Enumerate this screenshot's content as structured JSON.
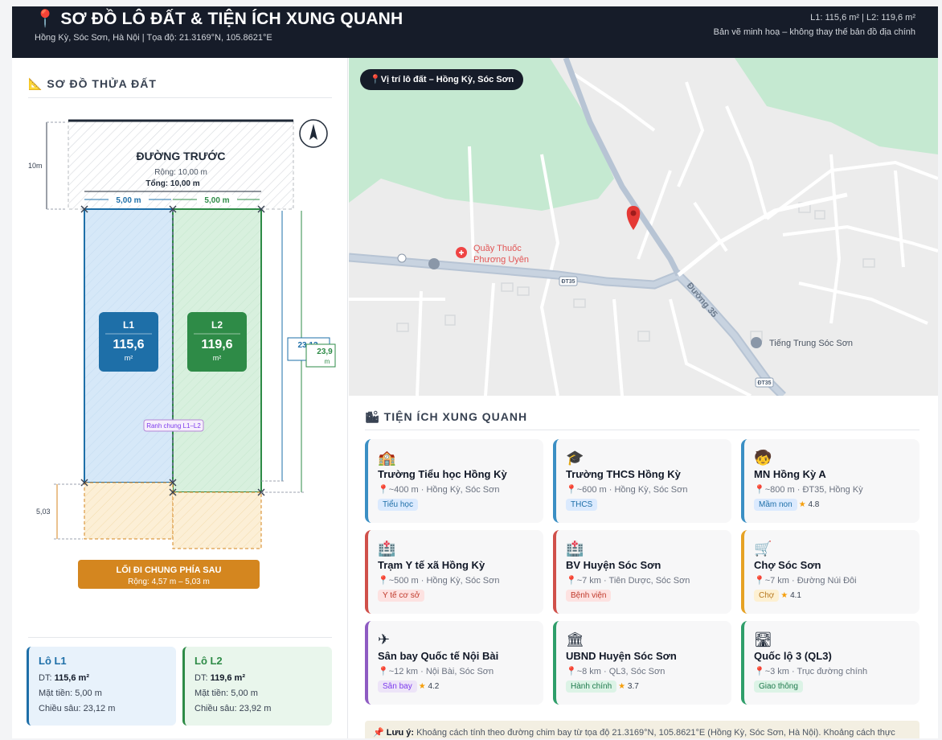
{
  "header": {
    "title": "SƠ ĐỒ LÔ ĐẤT & TIỆN ÍCH XUNG QUANH",
    "subtitle": "Hồng Kỳ, Sóc Sơn, Hà Nội  |  Tọa độ: 21.3169°N, 105.8621°E",
    "areas": "L1: 115,6 m²  |  L2: 119,6 m²",
    "disclaimer": "Bản vẽ minh hoạ – không thay thế bản đồ địa chính"
  },
  "plot": {
    "section_title": "SƠ ĐỒ THỬA ĐẤT",
    "front_road": {
      "label": "ĐƯỜNG TRƯỚC",
      "width": "Rộng: 10,00 m",
      "total": "Tổng: 10,00 m"
    },
    "road_depth_label": "10m",
    "frontage_left": "5,00 m",
    "frontage_right": "5,00 m",
    "lot1": {
      "code": "L1",
      "area": "115,6",
      "unit": "m²",
      "depth": "23,12"
    },
    "lot2": {
      "code": "L2",
      "area": "119,6",
      "unit": "m²",
      "depth": "23,9",
      "depth_unit": "m"
    },
    "shared_boundary": "Ranh chung L1–L2",
    "back_depth": "5,03",
    "back_path": {
      "label": "LỐI ĐI CHUNG PHÍA SAU",
      "width": "Rộng: 4,57 m – 5,03 m"
    }
  },
  "lot_cards": [
    {
      "title": "Lô L1",
      "area_label": "DT: ",
      "area": "115,6 m²",
      "frontage": "Mặt tiền: 5,00 m",
      "depth": "Chiều sâu: 23,12 m"
    },
    {
      "title": "Lô L2",
      "area_label": "DT: ",
      "area": "119,6 m²",
      "frontage": "Mặt tiền: 5,00 m",
      "depth": "Chiều sâu: 23,92 m"
    }
  ],
  "map": {
    "badge": "Vị trí lô đất – Hồng Kỳ, Sóc Sơn",
    "pharmacy": "Quầy Thuốc",
    "pharmacy2": "Phương Uyên",
    "school": "Tiếng Trung Sóc Sơn",
    "road_name": "Đường 35",
    "road_code1": "ĐT35",
    "road_code2": "ĐT35"
  },
  "amenities": {
    "section_title": "TIỆN ÍCH XUNG QUANH",
    "items": [
      {
        "icon": "school-icon",
        "glyph": "🏫",
        "name": "Trường Tiểu học Hồng Kỳ",
        "dist": "~400 m · Hồng Kỳ, Sóc Sơn",
        "tag": "Tiểu học",
        "rating": "",
        "color": "#3b8fc4",
        "tag_bg": "#dbeafe",
        "tag_fg": "#1e6fa8"
      },
      {
        "icon": "graduation-cap-icon",
        "glyph": "🎓",
        "name": "Trường THCS Hồng Kỳ",
        "dist": "~600 m · Hồng Kỳ, Sóc Sơn",
        "tag": "THCS",
        "rating": "",
        "color": "#3b8fc4",
        "tag_bg": "#dbeafe",
        "tag_fg": "#1e6fa8"
      },
      {
        "icon": "child-icon",
        "glyph": "🧒",
        "name": "MN Hồng Kỳ A",
        "dist": "~800 m · ĐT35, Hồng Kỳ",
        "tag": "Mầm non",
        "rating": "4.8",
        "color": "#3b8fc4",
        "tag_bg": "#dbeafe",
        "tag_fg": "#1e6fa8"
      },
      {
        "icon": "clinic-icon",
        "glyph": "🏥",
        "name": "Trạm Y tế xã Hồng Kỳ",
        "dist": "~500 m · Hồng Kỳ, Sóc Sơn",
        "tag": "Y tế cơ sở",
        "rating": "",
        "color": "#d0504a",
        "tag_bg": "#fde2e1",
        "tag_fg": "#c0392b"
      },
      {
        "icon": "hospital-icon",
        "glyph": "🏥",
        "name": "BV Huyện Sóc Sơn",
        "dist": "~7 km · Tiên Dược, Sóc Sơn",
        "tag": "Bệnh viện",
        "rating": "",
        "color": "#d0504a",
        "tag_bg": "#fde2e1",
        "tag_fg": "#c0392b"
      },
      {
        "icon": "shopping-cart-icon",
        "glyph": "🛒",
        "name": "Chợ Sóc Sơn",
        "dist": "~7 km · Đường Núi Đôi",
        "tag": "Chợ",
        "rating": "4.1",
        "color": "#e6a224",
        "tag_bg": "#fdf0d2",
        "tag_fg": "#b7791f"
      },
      {
        "icon": "airplane-icon",
        "glyph": "✈",
        "name": "Sân bay Quốc tế Nội Bài",
        "dist": "~12 km · Nội Bài, Sóc Sơn",
        "tag": "Sân bay",
        "rating": "4.2",
        "color": "#8e5bc2",
        "tag_bg": "#ede4f8",
        "tag_fg": "#7c3aed"
      },
      {
        "icon": "government-building-icon",
        "glyph": "🏛",
        "name": "UBND Huyện Sóc Sơn",
        "dist": "~8 km · QL3, Sóc Sơn",
        "tag": "Hành chính",
        "rating": "3.7",
        "color": "#2f9e6a",
        "tag_bg": "#dcf3e6",
        "tag_fg": "#1f7a4d"
      },
      {
        "icon": "road-icon",
        "glyph": "🛣",
        "name": "Quốc lộ 3 (QL3)",
        "dist": "~3 km · Trục đường chính",
        "tag": "Giao thông",
        "rating": "",
        "color": "#2f9e6a",
        "tag_bg": "#dcf3e6",
        "tag_fg": "#1f7a4d"
      }
    ],
    "note_label": "Lưu ý:",
    "note_text": "Khoảng cách tính theo đường chim bay từ tọa độ 21.3169°N, 105.8621°E (Hồng Kỳ, Sóc Sơn, Hà Nội). Khoảng cách thực"
  },
  "colors": {
    "header_bg": "#161c29",
    "lot1": "#1e6fa8",
    "lot2": "#2e8b47",
    "path": "#d4861f"
  }
}
